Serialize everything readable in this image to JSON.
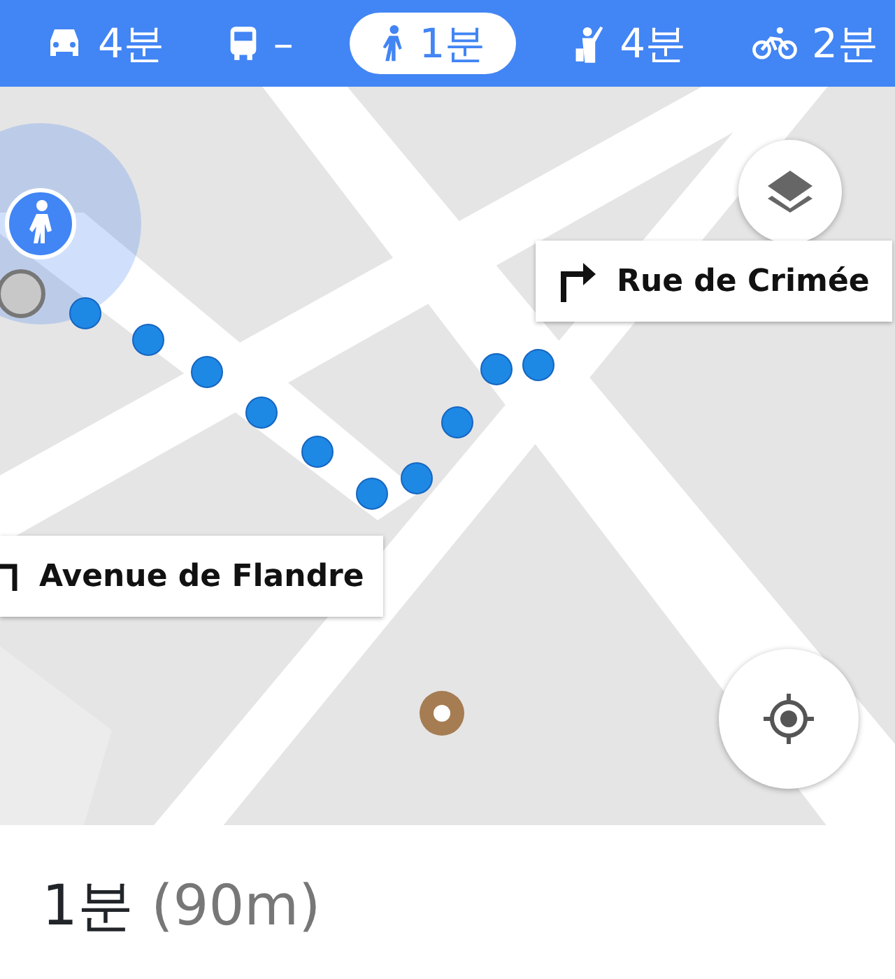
{
  "modes": [
    {
      "kind": "car",
      "label": "4분",
      "selected": false
    },
    {
      "kind": "bus",
      "label": "–",
      "selected": false
    },
    {
      "kind": "walk",
      "label": "1분",
      "selected": true
    },
    {
      "kind": "ride",
      "label": "4분",
      "selected": false
    },
    {
      "kind": "bike",
      "label": "2분",
      "selected": false
    }
  ],
  "turns": [
    {
      "kind": "right",
      "street": "Rue de Crimée"
    },
    {
      "kind": "left",
      "street": "Avenue de Flandre"
    }
  ],
  "summary": {
    "duration": "1분",
    "distance": "(90m)"
  }
}
